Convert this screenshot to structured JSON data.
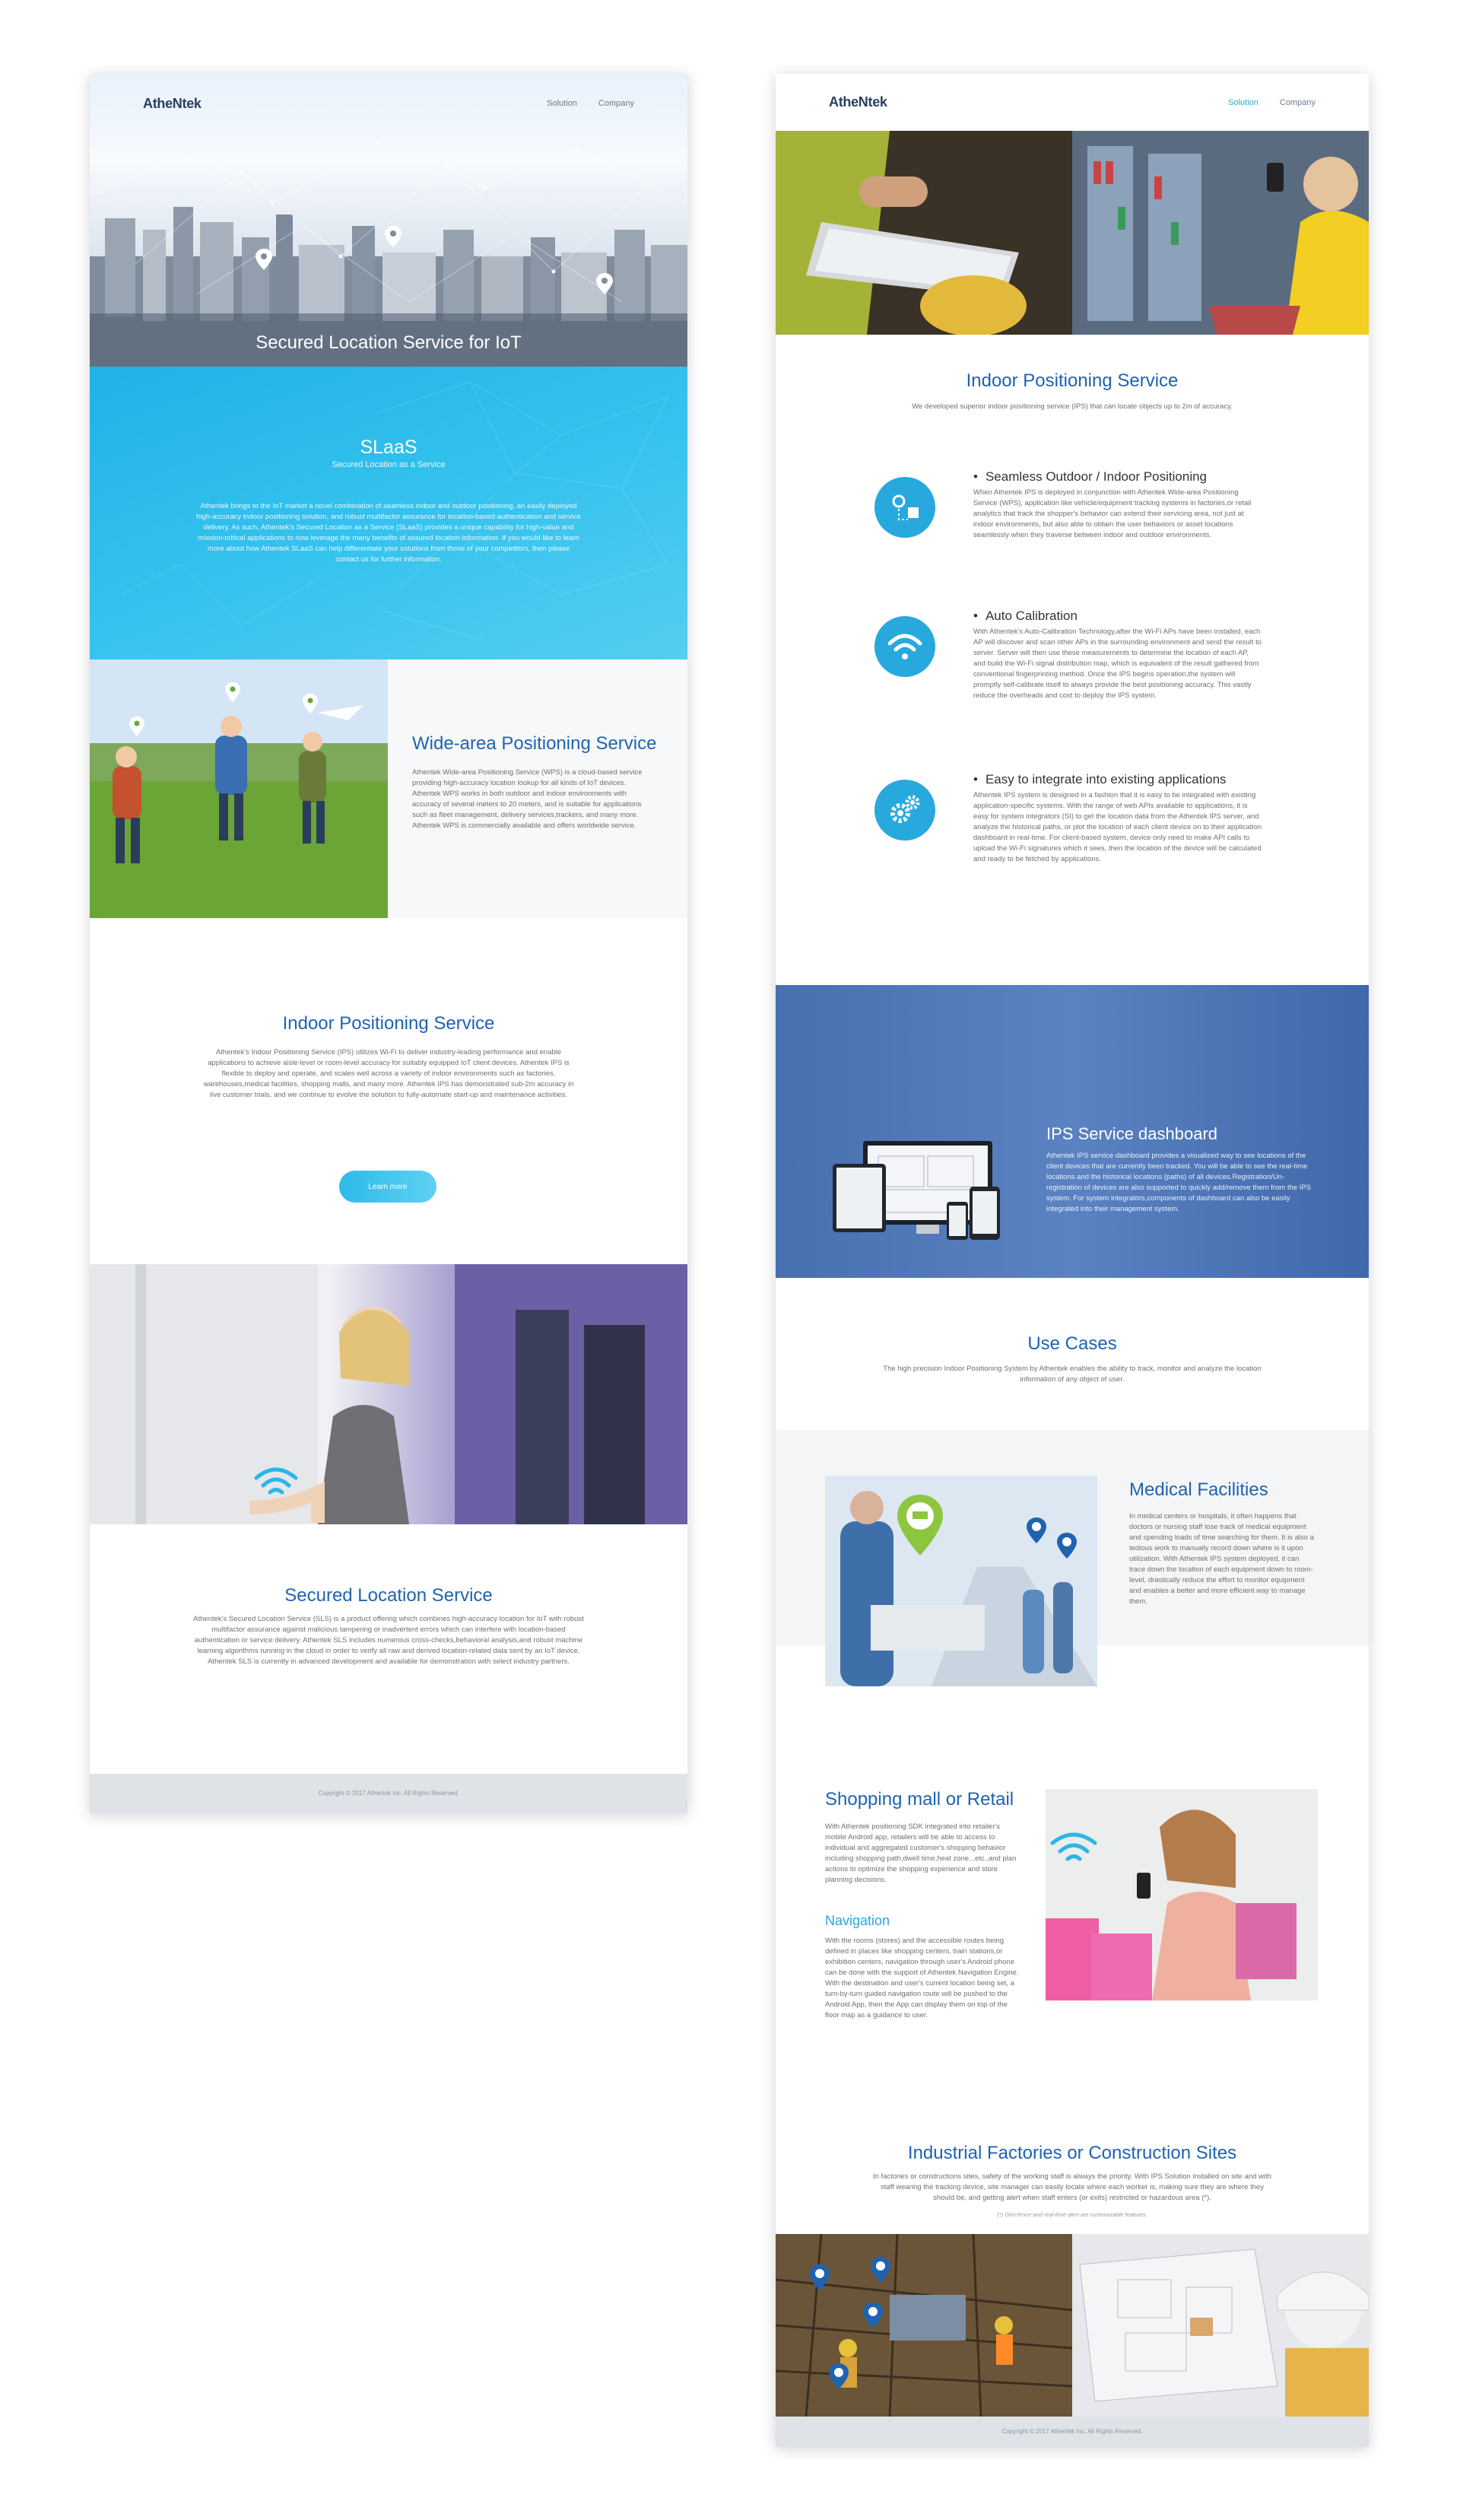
{
  "colors": {
    "accent": "#27a8d8",
    "title_blue": "#1f63b0",
    "slaas_bg": "#21b1e6",
    "dashboard_bg": "#4f77b8",
    "footer_bg": "#dfe3e7"
  },
  "page_a": {
    "logo": "AtheNtek",
    "nav": [
      "Solution",
      "Company"
    ],
    "hero_title": "Secured Location Service for IoT",
    "slaas": {
      "title": "SLaaS",
      "subtitle": "Secured Location as a Service",
      "text": "Athentek brings to the IoT market a novel combination of seamless indoor and outdoor positioning, an easily deployed high-accuracy indoor positioning solution, and robust multifactor assurance for location-based authentication and service delivery. As such, Athentek's Secured Location as a Service (SLaaS) provides a unique capability for high-value and mission-critical applications to now leverage the many benefits of assured location information. If you would like to learn more about how Athentek SLaaS can help differentiate your solutions from those of your competitors, then please contact us for further information."
    },
    "wide": {
      "title": "Wide-area Positioning Service",
      "text": "Athentek Wide-area Positioning Service (WPS) is a cloud-based service providing high-accuracy location lookup for all kinds of IoT devices. Athentek WPS works in both outdoor and indoor environments with accuracy of several meters to 20 meters, and is suitable for applications such as fleet management, delivery services,trackers, and many more. Athentek WPS is commercially available and offers worldwide service."
    },
    "ips": {
      "title": "Indoor Positioning Service",
      "text": "Athentek's Indoor Positioning Service (IPS) utilizes Wi-Fi to deliver industry-leading performance and enable applications to achieve aisle-level or room-level accuracy for suitably equipped IoT client devices. Athentek IPS is flexible to deploy and operate, and scales well across a variety of indoor environments such as factories, warehouses,medical facilities, shopping malls, and many more. Athentek IPS has demonstrated sub-2m accuracy in live customer trials, and we continue to evolve the solution to fully-automate start-up and maintenance activities.",
      "button": "Learn more"
    },
    "sls": {
      "title": "Secured Location Service",
      "text": "Athentek's Secured Location Service (SLS) is a product offering which combines high-accuracy location for IoT with robust multifactor assurance against malicious tampering or inadvertent errors which can interfere with location-based authentication or service delivery. Athentek SLS includes numerous cross-checks,behavioral analysis,and robust machine learning algorithms running in the cloud in order to verify all raw and derived location-related data sent by an IoT device. Athentek SLS is currently in advanced development and available for demonstration with select industry partners."
    },
    "footer": "Copyright © 2017 Athentek Inc. All Rights Reserved."
  },
  "page_b": {
    "logo": "AtheNtek",
    "nav": [
      "Solution",
      "Company"
    ],
    "ips_title": "Indoor Positioning Service",
    "ips_subtitle": "We developed superior indoor positioning service (IPS) that can locate objects up to 2m of accuracy.",
    "features": [
      {
        "title": "Seamless Outdoor / Indoor Positioning",
        "icon": "map-marker-icon",
        "text": "When Athentek IPS is deployed in conjunction with Athentek Wide-area Positioning Service (WPS), application like vehicle/equipment tracking systems in factories,or retail analytics that track the shopper's behavior can extend their servicing area, not just at indoor environments, but also able to obtain the user behaviors or asset locations seamlessly when they traverse between indoor and outdoor environments."
      },
      {
        "title": "Auto Calibration",
        "icon": "wifi-icon",
        "text": "With Athentek's Auto-Calibration Technology,after the Wi-Fi APs have been installed, each AP will discover and scan other APs in the surrounding environment and send the result to server. Server will then use these measurements to determine the location of each AP, and build the Wi-Fi signal distribution map, which is equivalent of the result gathered from conventional fingerprinting method. Once the IPS begins operation,the system will promptly self-calibrate itself to always provide the best positioning accuracy. This vastly reduce the overheads and cost to deploy the IPS system."
      },
      {
        "title": "Easy to integrate into existing applications",
        "icon": "gears-icon",
        "text": "Athentek IPS system is designed in a fashion that it is easy to be integrated with existing application-specific systems. With the range of web APIs available to applications, it is easy for system integrators (SI) to get the location data from the Athentek IPS server, and analyze the historical paths, or plot the location of each client device on to their application dashboard in real-time. For client-based system, device only need to make API calls to upload the Wi-Fi signatures which it sees, then the location of the device will be calculated and ready to be fetched by applications."
      }
    ],
    "dashboard": {
      "title": "IPS Service dashboard",
      "text": "Athentek IPS service dashboard provides a visualized way to see locations of the client devices that are currently been tracked. You will be able to see the real-time locations and the historical locations (paths) of all devices.Registration/Un-registration of devices are also supported to quickly add/remove them from the IPS system. For system integrators,components of dashboard can also be easily integrated into their management system."
    },
    "use_cases": {
      "title": "Use Cases",
      "text": "The high precision Indoor Positioning System by Athentek enables the ability to track, monitor and analyze the location information of any object of user."
    },
    "medical": {
      "title": "Medical Facilities",
      "text": "In medical centers or hospitals, it often happens that doctors or nursing staff lose track of medical equipment and spending loads of time searching for them. It is also a tedious work to manually record down where is it upon utilization. With Athentek IPS system deployed, it can trace down the location of each equipment down to room-level, drastically reduce the effort to monitor equipment and enables a better and more efficient way to manage them."
    },
    "shopping": {
      "title": "Shopping mall or Retail",
      "text": "With Athentek positioning SDK integrated into retailer's mobile Android app, retailers will be able to access to individual and aggregated customer's shopping behavior including shopping path,dwell time,heat zone...etc.,and plan actions to optimize the shopping experience and store planning decisions.",
      "nav_title": "Navigation",
      "nav_text": "With the rooms (stores) and the accessible routes being defined in places like shopping centers, train stations,or exhibition centers, navigation through user's Android phone can be done with the support of Athentek Navigation Engine. With the destination and user's current location being set, a turn-by-turn guided navigation route will be pushed to the Android App, then the App can display them on top of the floor map as a guidance to user."
    },
    "industrial": {
      "title": "Industrial Factories or Construction Sites",
      "text": "In factories or constructions sites, safety of the working staff is always the priority. With IPS Solution installed on site and with staff wearing the tracking device, site manager can easily locate where each worker is, making sure they are where they should be, and getting alert when staff enters (or exits) restricted or hazardous area (*).",
      "note": "(*) Geo-fence and real-time alert are customizable features."
    },
    "footer": "Copyright © 2017 Athentek Inc. All Rights Reserved."
  }
}
